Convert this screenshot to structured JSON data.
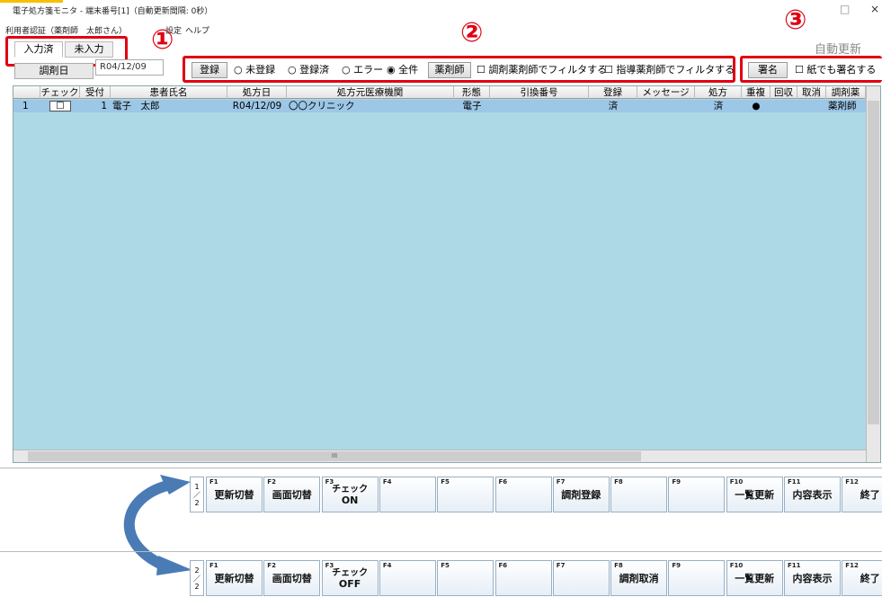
{
  "window": {
    "title": "電子処方箋モニタ - 端末番号[1]（自動更新間隔: 0秒）",
    "minimize": "□",
    "close": "×"
  },
  "menu": {
    "items": [
      "利用者認証（薬剤師　太郎さん）",
      "設定",
      "ヘルプ"
    ]
  },
  "auto_update": "自動更新",
  "tabs": [
    {
      "label": "入力済"
    },
    {
      "label": "未入力"
    }
  ],
  "markers": [
    "①",
    "②",
    "③"
  ],
  "dispense_date": {
    "label": "調剤日",
    "value": "R04/12/09"
  },
  "filter": {
    "register_button": "登録",
    "options": [
      {
        "label": "未登録",
        "selected": false
      },
      {
        "label": "登録済",
        "selected": false
      },
      {
        "label": "エラー",
        "selected": false
      },
      {
        "label": "全件",
        "selected": true
      }
    ],
    "pharmacist_button": "薬剤師",
    "checkbox_dispense": "調剤薬剤師でフィルタする",
    "checkbox_guidance": "指導薬剤師でフィルタする"
  },
  "signature": {
    "button": "署名",
    "checkbox": "紙でも署名する"
  },
  "table": {
    "columns": [
      "チェック",
      "受付",
      "患者氏名",
      "処方日",
      "処方元医療機関",
      "形態",
      "引換番号",
      "登録",
      "メッセージ",
      "処方",
      "重複",
      "回収",
      "取消",
      "調剤薬"
    ],
    "rows": [
      {
        "no": "1",
        "check": "☐",
        "reception": "1",
        "patient": "電子　太郎",
        "date": "R04/12/09",
        "institution": "〇〇クリニック",
        "form": "電子",
        "exchange": "",
        "registered": "済",
        "message": "",
        "prescription": "済",
        "duplicate": "●",
        "collect": "",
        "cancel": "",
        "pharmacist": "薬剤師"
      }
    ],
    "hscroll_thumb": "III"
  },
  "fkeys_page1": {
    "page": [
      "1",
      "／",
      "2"
    ],
    "keys": [
      {
        "fn": "F1",
        "label": "更新切替"
      },
      {
        "fn": "F2",
        "label": "画面切替"
      },
      {
        "fn": "F3",
        "label": "チェック",
        "sub": "ON"
      },
      {
        "fn": "F4",
        "label": ""
      },
      {
        "fn": "F5",
        "label": ""
      },
      {
        "fn": "F6",
        "label": ""
      },
      {
        "fn": "F7",
        "label": "調剤登録"
      },
      {
        "fn": "F8",
        "label": ""
      },
      {
        "fn": "F9",
        "label": ""
      },
      {
        "fn": "F10",
        "label": "一覧更新"
      },
      {
        "fn": "F11",
        "label": "内容表示"
      },
      {
        "fn": "F12",
        "label": "終了"
      }
    ]
  },
  "fkeys_page2": {
    "page": [
      "2",
      "／",
      "2"
    ],
    "keys": [
      {
        "fn": "F1",
        "label": "更新切替"
      },
      {
        "fn": "F2",
        "label": "画面切替"
      },
      {
        "fn": "F3",
        "label": "チェック",
        "sub": "OFF"
      },
      {
        "fn": "F4",
        "label": ""
      },
      {
        "fn": "F5",
        "label": ""
      },
      {
        "fn": "F6",
        "label": ""
      },
      {
        "fn": "F7",
        "label": ""
      },
      {
        "fn": "F8",
        "label": "調剤取消"
      },
      {
        "fn": "F9",
        "label": ""
      },
      {
        "fn": "F10",
        "label": "一覧更新"
      },
      {
        "fn": "F11",
        "label": "内容表示"
      },
      {
        "fn": "F12",
        "label": "終了"
      }
    ]
  },
  "colors": {
    "accent_red": "#e00012",
    "grid_bg": "#add8e6",
    "selected_row": "#9cc7e6",
    "arrow": "#4a7bb5"
  }
}
